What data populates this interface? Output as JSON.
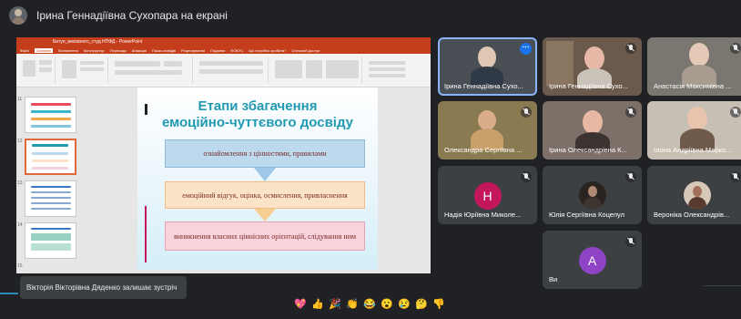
{
  "presenter": {
    "label": "Ірина Геннадіївна Сухопара на екрані"
  },
  "shared_screen": {
    "window_title": "Битуп_виховного_студ НПФД - PowerPoint",
    "ribbon_tabs": [
      "Файл",
      "Основне",
      "Вставлення",
      "Конструктор",
      "Переходи",
      "Анімація",
      "Показ слайдів",
      "Рецензування",
      "Подання",
      "ФОКУС",
      "Що потрібно зробити?",
      "Спільний доступ"
    ],
    "active_ribbon_tab": "Основне",
    "thumbnail_numbers": [
      "11",
      "12",
      "13",
      "14",
      "15"
    ],
    "slide": {
      "title_line1": "Етапи збагачення",
      "title_line2": "емоційно-чуттєвого досвіду",
      "box1": "ознайомлення з цінностями, правилами",
      "box2": "емоційний відгук, оцінка, осмислення, привласнення",
      "box3": "виникнення власних ціннісних орієнтацій, слідування ним"
    }
  },
  "participants": [
    {
      "name": "Ірина Геннадіївна Сухо...",
      "muted": false,
      "has_more_menu": true,
      "speaking": true
    },
    {
      "name": "Ірина Геннадіївна Сухо...",
      "muted": true
    },
    {
      "name": "Анастасія Максимівна ...",
      "muted": true
    },
    {
      "name": "Олександра Сергіївна ...",
      "muted": true
    },
    {
      "name": "Ірина Олександрівна К...",
      "muted": true
    },
    {
      "name": "Ілона Андріївна Марко...",
      "muted": true
    },
    {
      "name": "Надія Юріївна Миколе...",
      "muted": true,
      "avatar_letter": "Н",
      "avatar_color": "#c2185b"
    },
    {
      "name": "Юлія Сергіївна Коцепул",
      "muted": true
    },
    {
      "name": "Вероніка Олександрів...",
      "muted": true
    },
    {
      "name": "Ви",
      "muted": true,
      "avatar_letter": "А",
      "avatar_color": "#8e44c4"
    }
  ],
  "toast": {
    "text": "Вікторія Вікторівна Дяденко залишає зустріч"
  },
  "reactions": [
    "💖",
    "👍",
    "🎉",
    "👏",
    "😂",
    "😮",
    "😢",
    "🤔",
    "👎"
  ]
}
